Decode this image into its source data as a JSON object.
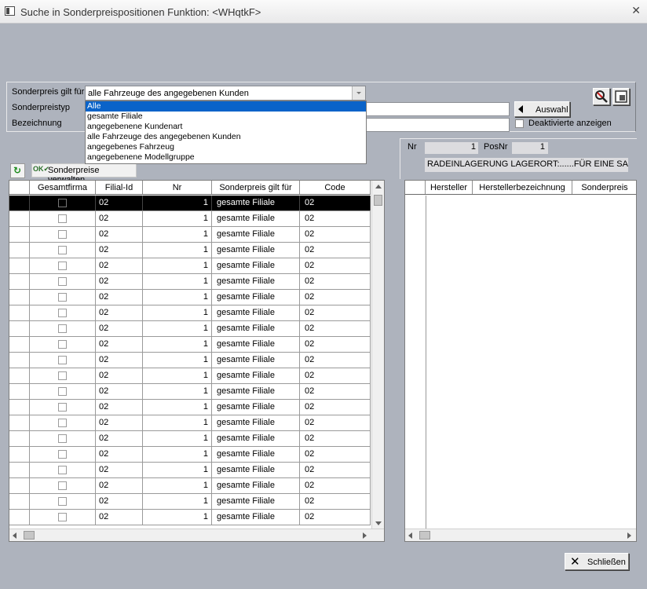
{
  "window": {
    "title": "Suche in Sonderpreispositionen  Funktion: <WHqtkF>",
    "close_glyph": "✕"
  },
  "form": {
    "sonderpreis_label": "Sonderpreis gilt für",
    "sonderpreis_value": "alle Fahrzeuge des angegebenen Kunden",
    "sonderpreistyp_label": "Sonderpreistyp",
    "bezeichnung_label": "Bezeichnung",
    "auswahl_label": "Auswahl",
    "deaktivierte_label": "Deaktivierte anzeigen",
    "dropdown_options": [
      "Alle",
      "gesamte Filiale",
      "angegebenene Kundenart",
      "alle Fahrzeuge des angegebenen Kunden",
      "angegebenes Fahrzeug",
      "angegebenene Modellgruppe"
    ],
    "dropdown_selected_index": 0
  },
  "info": {
    "nr_label": "Nr",
    "nr_value": "1",
    "posnr_label": "PosNr",
    "posnr_value": "1",
    "text": "RADEINLAGERUNG LAGERORT:......FÜR EINE SAI"
  },
  "toolbar": {
    "refresh_icon": "refresh-icon",
    "sonderpreise_label": "Sonderpreise verwalten"
  },
  "left_grid": {
    "columns": [
      "",
      "Gesamtfirma",
      "Filial-Id",
      "Nr",
      "Sonderpreis gilt für",
      "Code"
    ],
    "rows": [
      {
        "filial": "02",
        "nr": "1",
        "gilt": "gesamte Filiale",
        "code": "02"
      },
      {
        "filial": "02",
        "nr": "1",
        "gilt": "gesamte Filiale",
        "code": "02"
      },
      {
        "filial": "02",
        "nr": "1",
        "gilt": "gesamte Filiale",
        "code": "02"
      },
      {
        "filial": "02",
        "nr": "1",
        "gilt": "gesamte Filiale",
        "code": "02"
      },
      {
        "filial": "02",
        "nr": "1",
        "gilt": "gesamte Filiale",
        "code": "02"
      },
      {
        "filial": "02",
        "nr": "1",
        "gilt": "gesamte Filiale",
        "code": "02"
      },
      {
        "filial": "02",
        "nr": "1",
        "gilt": "gesamte Filiale",
        "code": "02"
      },
      {
        "filial": "02",
        "nr": "1",
        "gilt": "gesamte Filiale",
        "code": "02"
      },
      {
        "filial": "02",
        "nr": "1",
        "gilt": "gesamte Filiale",
        "code": "02"
      },
      {
        "filial": "02",
        "nr": "1",
        "gilt": "gesamte Filiale",
        "code": "02"
      },
      {
        "filial": "02",
        "nr": "1",
        "gilt": "gesamte Filiale",
        "code": "02"
      },
      {
        "filial": "02",
        "nr": "1",
        "gilt": "gesamte Filiale",
        "code": "02"
      },
      {
        "filial": "02",
        "nr": "1",
        "gilt": "gesamte Filiale",
        "code": "02"
      },
      {
        "filial": "02",
        "nr": "1",
        "gilt": "gesamte Filiale",
        "code": "02"
      },
      {
        "filial": "02",
        "nr": "1",
        "gilt": "gesamte Filiale",
        "code": "02"
      },
      {
        "filial": "02",
        "nr": "1",
        "gilt": "gesamte Filiale",
        "code": "02"
      },
      {
        "filial": "02",
        "nr": "1",
        "gilt": "gesamte Filiale",
        "code": "02"
      },
      {
        "filial": "02",
        "nr": "1",
        "gilt": "gesamte Filiale",
        "code": "02"
      },
      {
        "filial": "02",
        "nr": "1",
        "gilt": "gesamte Filiale",
        "code": "02"
      },
      {
        "filial": "02",
        "nr": "1",
        "gilt": "gesamte Filiale",
        "code": "02"
      },
      {
        "filial": "02",
        "nr": "1",
        "gilt": "gesamte Filiale",
        "code": "02"
      }
    ]
  },
  "right_grid": {
    "columns": [
      "",
      "Hersteller",
      "Herstellerbezeichnung",
      "Sonderpreis"
    ]
  },
  "footer": {
    "close_label": "Schließen"
  }
}
